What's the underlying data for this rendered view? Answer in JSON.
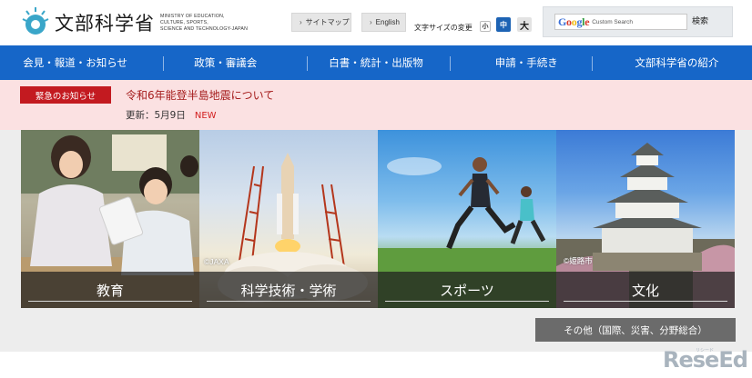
{
  "header": {
    "logo_name": "文部科学省",
    "logo_english": [
      "MINISTRY OF EDUCATION,",
      "CULTURE, SPORTS,",
      "SCIENCE AND TECHNOLOGY-JAPAN"
    ],
    "sitemap_label": "サイトマップ",
    "english_label": "English",
    "font_size_label": "文字サイズの変更",
    "font_small": "小",
    "font_medium": "中",
    "font_large": "大",
    "search_google": "Google",
    "search_custom": "Custom Search",
    "search_button": "検索"
  },
  "nav": {
    "items": [
      "会見・報道・お知らせ",
      "政策・審議会",
      "白書・統計・出版物",
      "申請・手続き",
      "文部科学省の紹介"
    ]
  },
  "alert": {
    "badge": "緊急のお知らせ",
    "title": "令和6年能登半島地震について",
    "updated": "更新：5月9日",
    "new_label": "NEW"
  },
  "tiles": [
    {
      "label": "教育",
      "credit": ""
    },
    {
      "label": "科学技術・学術",
      "credit": "©JAXA"
    },
    {
      "label": "スポーツ",
      "credit": ""
    },
    {
      "label": "文化",
      "credit": "©姫路市"
    }
  ],
  "other_button": "その他（国際、災害、分野総合）",
  "watermark": {
    "main": "ReseEd",
    "small": "リシード"
  },
  "colors": {
    "nav_bg": "#1666c8",
    "alert_bg": "#fbe1e2",
    "alert_badge": "#c31a20",
    "font_mid_active": "#1d63b4"
  }
}
